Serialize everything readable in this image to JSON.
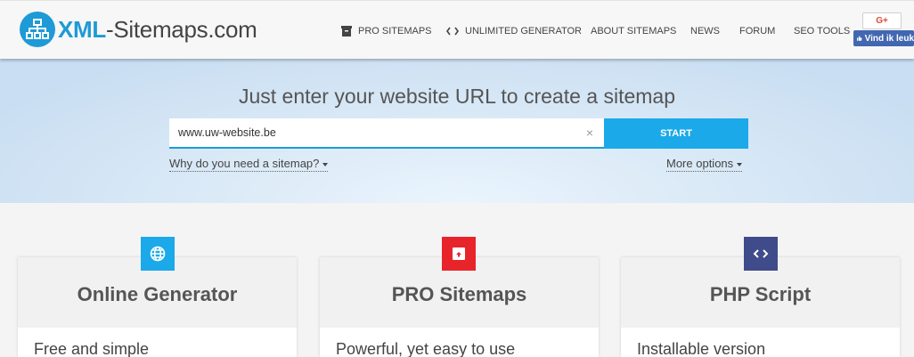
{
  "brand": {
    "part1": "XML",
    "part2": "-Sitemaps.com",
    "color": "#1e9ad6"
  },
  "nav": {
    "pro_sitemaps": "PRO SITEMAPS",
    "unlimited_generator": "UNLIMITED GENERATOR",
    "about_sitemaps": "ABOUT SITEMAPS",
    "news": "NEWS",
    "forum": "FORUM",
    "seo_tools": "SEO TOOLS"
  },
  "social": {
    "gplus": "G+",
    "fb_like": "Vind ik leuk"
  },
  "hero": {
    "title": "Just enter your website URL to create a sitemap",
    "url_value": "www.uw-website.be",
    "clear_symbol": "×",
    "start_label": "START",
    "why_link": "Why do you need a sitemap?",
    "more_options": "More options"
  },
  "cards": [
    {
      "title": "Online Generator",
      "desc": "Free and simple",
      "icon": "globe-icon",
      "color": "#1ba9e9"
    },
    {
      "title": "PRO Sitemaps",
      "desc": "Powerful, yet easy to use",
      "icon": "archive-icon",
      "color": "#e8242b"
    },
    {
      "title": "PHP Script",
      "desc": "Installable version",
      "icon": "code-icon",
      "color": "#3f4b8a"
    }
  ]
}
